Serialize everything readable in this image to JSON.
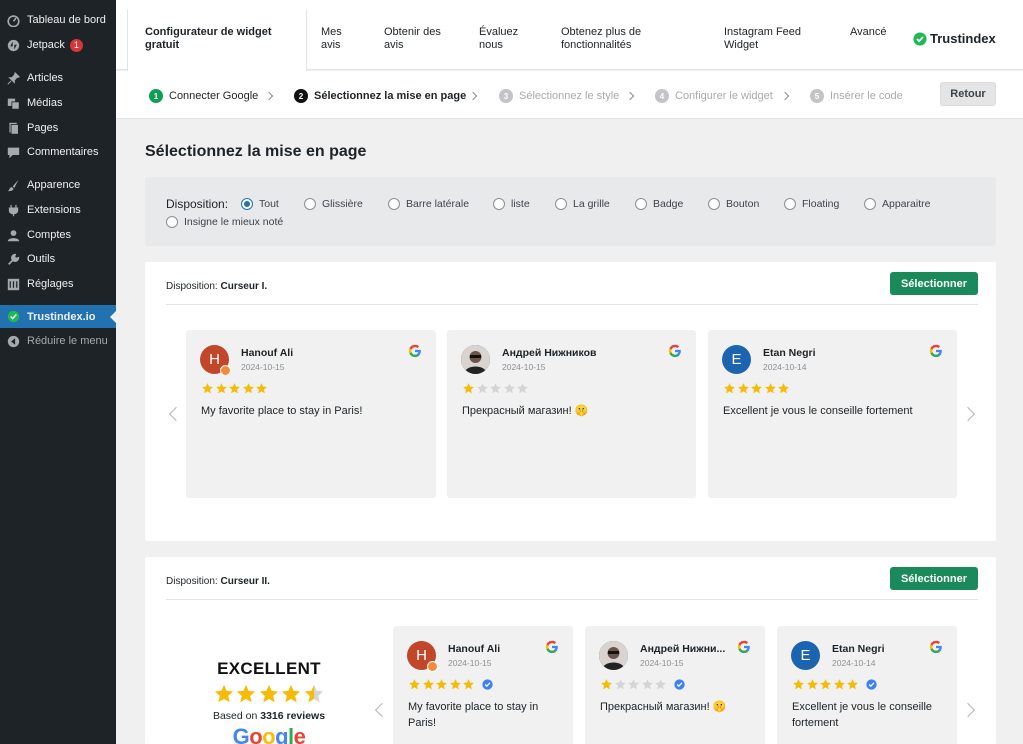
{
  "sidebar": {
    "items": [
      {
        "label": "Tableau de bord",
        "icon": "dashboard-icon"
      },
      {
        "label": "Jetpack",
        "icon": "jetpack-icon",
        "badge": "1"
      },
      {
        "label": "Articles",
        "icon": "pin-icon"
      },
      {
        "label": "Médias",
        "icon": "media-icon"
      },
      {
        "label": "Pages",
        "icon": "page-icon"
      },
      {
        "label": "Commentaires",
        "icon": "comment-icon"
      },
      {
        "label": "Apparence",
        "icon": "brush-icon"
      },
      {
        "label": "Extensions",
        "icon": "plugin-icon"
      },
      {
        "label": "Comptes",
        "icon": "user-icon"
      },
      {
        "label": "Outils",
        "icon": "wrench-icon"
      },
      {
        "label": "Réglages",
        "icon": "settings-icon"
      },
      {
        "label": "Trustindex.io",
        "icon": "trustindex-icon"
      },
      {
        "label": "Réduire le menu",
        "icon": "collapse-icon"
      }
    ]
  },
  "tabs": [
    {
      "line1": "Configurateur de widget",
      "line2": "gratuit"
    },
    {
      "line1": "Mes",
      "line2": "avis"
    },
    {
      "line1": "Obtenir des",
      "line2": "avis"
    },
    {
      "line1": "Évaluez",
      "line2": "nous"
    },
    {
      "line1": "Obtenez plus de",
      "line2": "fonctionnalités"
    },
    {
      "line1": "Instagram Feed",
      "line2": "Widget"
    },
    {
      "line1": "Avancé",
      "line2": ""
    }
  ],
  "brand": {
    "name": "Trustindex"
  },
  "steps": [
    {
      "num": "1",
      "label": "Connecter Google",
      "state": "done"
    },
    {
      "num": "2",
      "label": "Sélectionnez la mise en page",
      "state": "current"
    },
    {
      "num": "3",
      "label": "Sélectionnez le style",
      "state": "todo"
    },
    {
      "num": "4",
      "label": "Configurer le widget",
      "state": "todo"
    },
    {
      "num": "5",
      "label": "Insérer le code",
      "state": "todo"
    }
  ],
  "back_label": "Retour",
  "page_title": "Sélectionnez la mise en page",
  "filter": {
    "label": "Disposition:",
    "options": [
      "Tout",
      "Glissière",
      "Barre latérale",
      "liste",
      "La grille",
      "Badge",
      "Bouton",
      "Floating",
      "Apparaitre",
      "Insigne le mieux noté"
    ],
    "selected": "Tout"
  },
  "layouts": [
    {
      "prefix": "Disposition:",
      "name": "Curseur I.",
      "button": "Sélectionner"
    },
    {
      "prefix": "Disposition:",
      "name": "Curseur II.",
      "button": "Sélectionner"
    }
  ],
  "reviews": [
    {
      "initial": "H",
      "name": "Hanouf Ali",
      "date": "2024-10-15",
      "rating": 5,
      "text": "My favorite place to stay in Paris!"
    },
    {
      "initial": "",
      "name": "Андрей Нижников",
      "date": "2024-10-15",
      "rating": 1,
      "text": "Прекрасный магазин! 🤫"
    },
    {
      "initial": "E",
      "name": "Etan Negri",
      "date": "2024-10-14",
      "rating": 5,
      "text": "Excellent je vous le conseille fortement"
    }
  ],
  "reviews2": [
    {
      "initial": "H",
      "name": "Hanouf Ali",
      "date": "2024-10-15",
      "rating": 5,
      "text": "My favorite place to stay in Paris!"
    },
    {
      "initial": "",
      "name": "Андрей Нижни...",
      "date": "2024-10-15",
      "rating": 1,
      "text": "Прекрасный магазин! 🤫"
    },
    {
      "initial": "E",
      "name": "Etan Negri",
      "date": "2024-10-14",
      "rating": 5,
      "text": "Excellent je vous le conseille fortement"
    }
  ],
  "summary": {
    "title": "EXCELLENT",
    "rating": 4.5,
    "based_prefix": "Based on",
    "based_count": "3316 reviews",
    "logo": "Google"
  },
  "colors": {
    "accent": "#2271b1",
    "select_button": "#1a8a5a",
    "star": "#f6bb06",
    "sidebar_bg": "#1d2327"
  }
}
